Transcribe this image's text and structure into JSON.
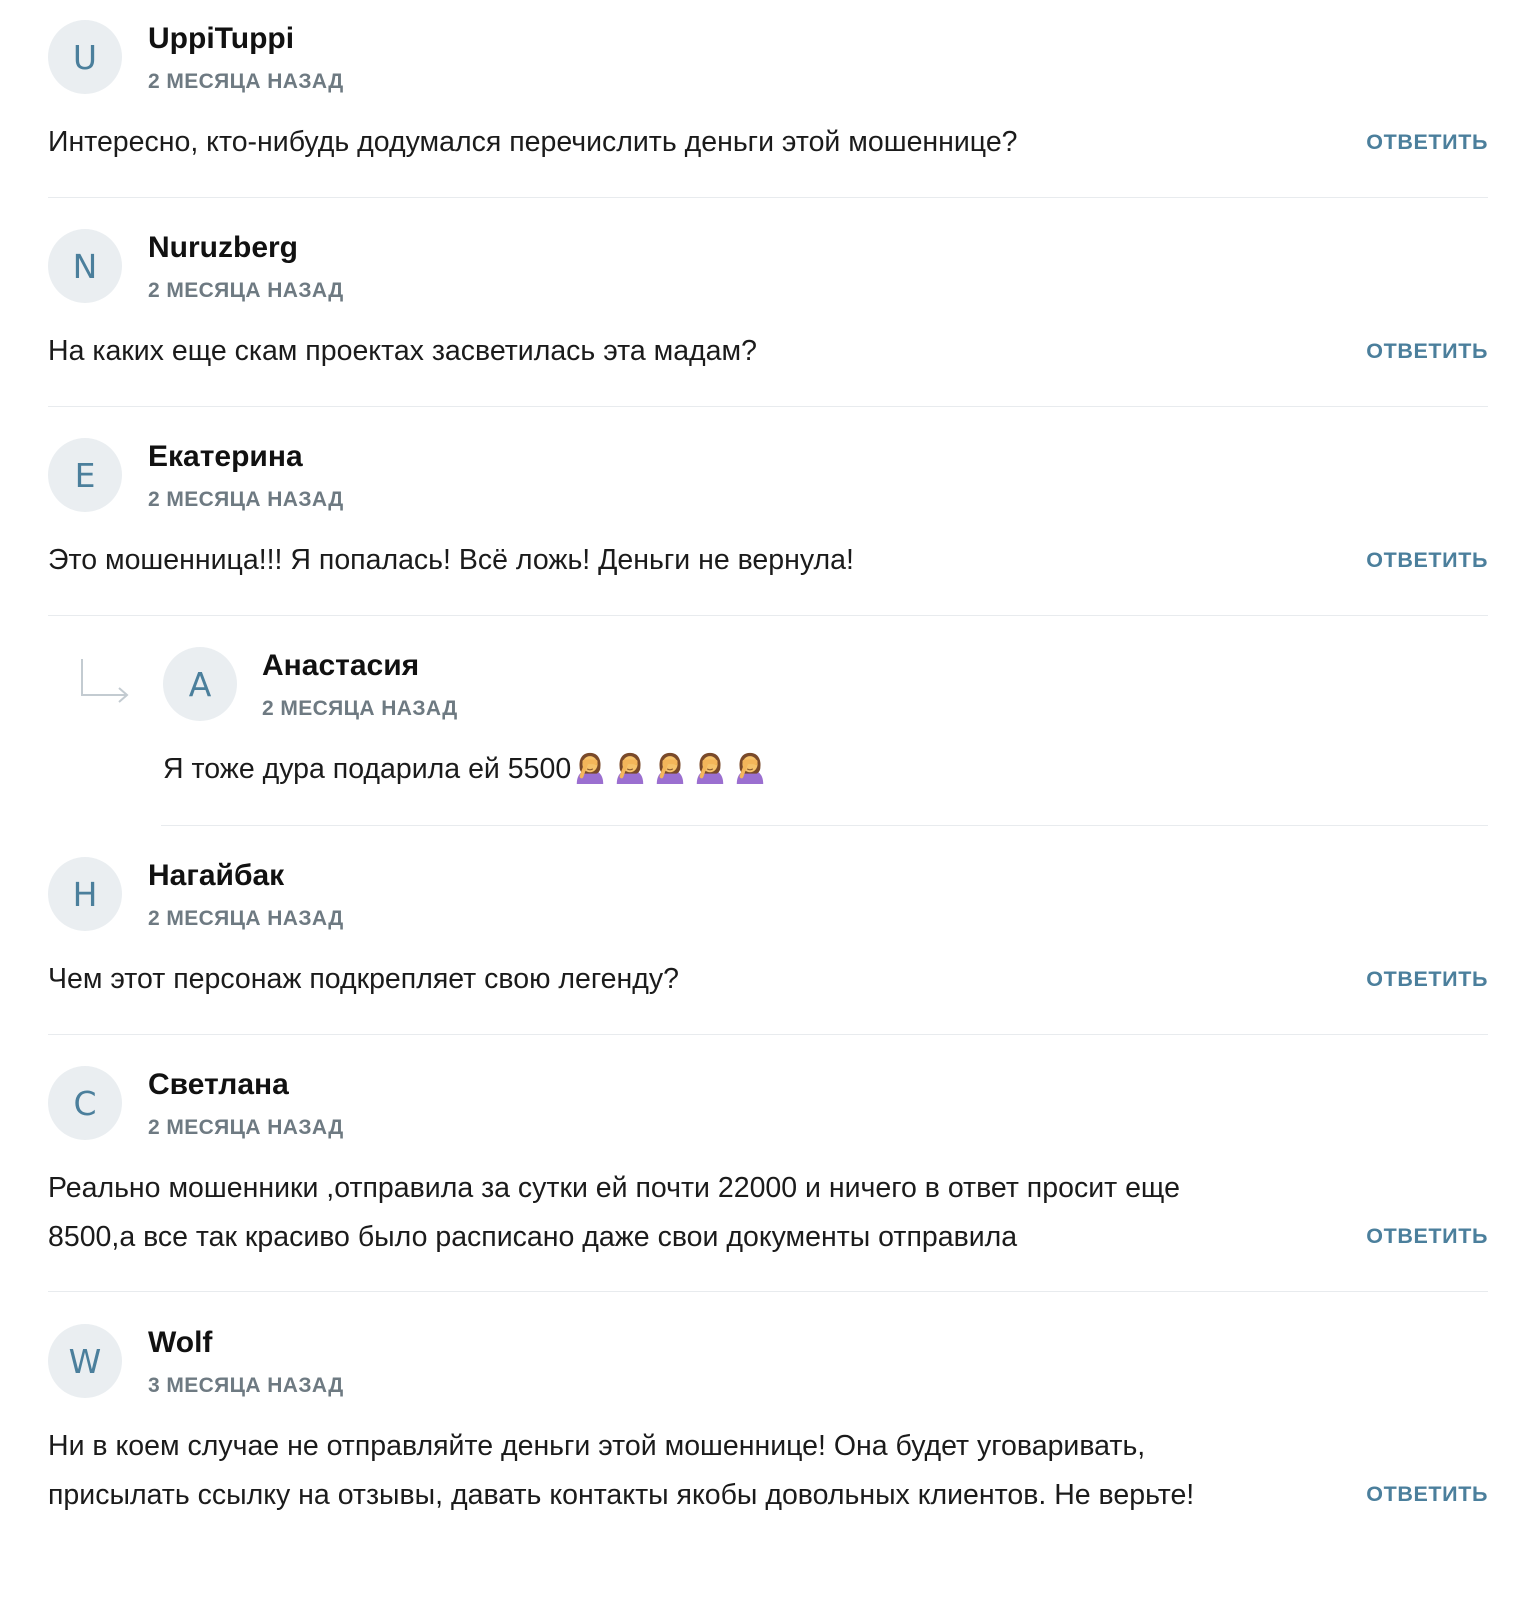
{
  "reply_label": "ответить",
  "comments": [
    {
      "initial": "U",
      "author": "UppiTuppi",
      "time": "2 месяца назад",
      "text": "Интересно, кто-нибудь додумался перечислить деньги этой мошеннице?"
    },
    {
      "initial": "N",
      "author": "Nuruzberg",
      "time": "2 месяца назад",
      "text": "На каких еще скам проектах засветилась эта мадам?"
    },
    {
      "initial": "Е",
      "author": "Екатерина",
      "time": "2 месяца назад",
      "text": "Это мошенница!!! Я попалась! Всё ложь! Деньги не вернула!"
    },
    {
      "initial": "А",
      "author": "Анастасия",
      "time": "2 месяца назад",
      "text": "Я тоже дура подарила ей 5500",
      "emoji": "woman-facepalming-icon",
      "emoji_count": 5
    },
    {
      "initial": "Н",
      "author": "Нагайбак",
      "time": "2 месяца назад",
      "text": "Чем этот персонаж подкрепляет свою легенду?"
    },
    {
      "initial": "С",
      "author": "Светлана",
      "time": "2 месяца назад",
      "text": "Реально мошенники ,отправила за сутки ей почти 22000 и ничего в ответ просит еще 8500,а все так красиво было расписано даже свои документы отправила"
    },
    {
      "initial": "W",
      "author": "Wolf",
      "time": "3 месяца назад",
      "text": "Ни в коем случае не отправляйте деньги этой мошеннице! Она будет уговаривать, присылать ссылку на отзывы, давать контакты якобы довольных клиентов. Не верьте!"
    }
  ],
  "colors": {
    "accent": "#4b7f9c",
    "avatar_bg": "#eaeef1",
    "meta_text": "#6e7a82",
    "divider": "#e8ebee"
  }
}
